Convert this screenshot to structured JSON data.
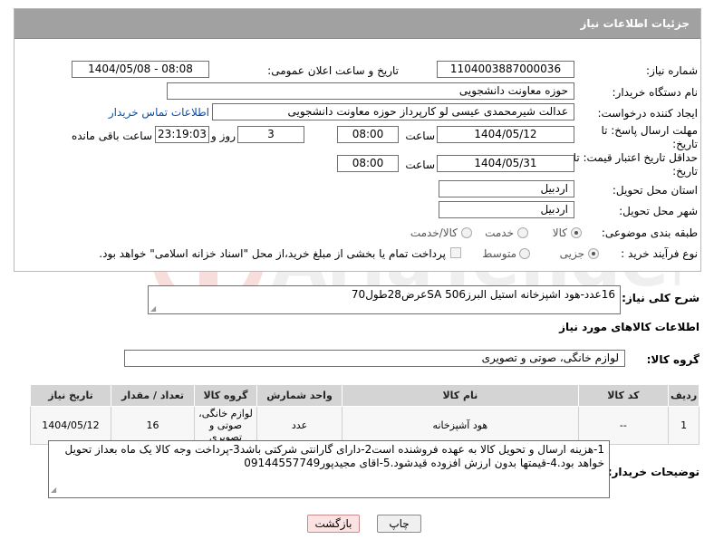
{
  "panel": {
    "title": "جزئیات اطلاعات نیاز"
  },
  "fields": {
    "need_number_label": "شماره نیاز:",
    "need_number": "1104003887000036",
    "announce_label": "تاریخ و ساعت اعلان عمومی:",
    "announce_value": "1404/05/08 - 08:08",
    "buyer_org_label": "نام دستگاه خریدار:",
    "buyer_org": "حوزه معاونت دانشجویی",
    "requester_label": "ایجاد کننده درخواست:",
    "requester": "عدالت شیرمحمدی عیسی لو کارپرداز حوزه معاونت دانشجویی",
    "contact_link": "اطلاعات تماس خریدار",
    "reply_deadline_label": "مهلت ارسال پاسخ: تا تاریخ:",
    "reply_date": "1404/05/12",
    "time_label": "ساعت",
    "reply_time": "08:00",
    "days": "3",
    "days_label": "روز و",
    "remaining_time": "23:19:03",
    "remaining_label": "ساعت باقی مانده",
    "validity_label": "حداقل تاریخ اعتبار قیمت: تا تاریخ:",
    "validity_date": "1404/05/31",
    "validity_time": "08:00",
    "province_label": "استان محل تحویل:",
    "province": "اردبیل",
    "city_label": "شهر محل تحویل:",
    "city": "اردبیل",
    "category_label": "طبقه بندی موضوعی:",
    "category_options": [
      "کالا",
      "خدمت",
      "کالا/خدمت"
    ],
    "process_label": "نوع فرآیند خرید :",
    "process_options": [
      "جزیی",
      "متوسط"
    ],
    "payment_note": "پرداخت تمام یا بخشی از مبلغ خرید،از محل \"اسناد خزانه اسلامی\" خواهد بود."
  },
  "description": {
    "label": "شرح کلی نیاز:",
    "text": "16عدد-هود اشپزخانه استیل البرز506 SAعرض28طول70"
  },
  "goods": {
    "section_title": "اطلاعات کالاهای مورد نیاز",
    "group_label": "گروه کالا:",
    "group_value": "لوازم خانگی، صوتی و تصویری",
    "columns": [
      "ردیف",
      "کد کالا",
      "نام کالا",
      "واحد شمارش",
      "گروه کالا",
      "تعداد / مقدار",
      "تاریخ نیاز"
    ],
    "rows": [
      [
        "1",
        "--",
        "هود آشپزخانه",
        "عدد",
        "لوازم خانگی، صوتی و تصویری",
        "16",
        "1404/05/12"
      ]
    ]
  },
  "buyer_notes": {
    "label": "توضیحات خریدار:",
    "text": "1-هزینه ارسال و تحویل کالا به عهده فروشنده است2-دارای گارانتی شرکتی باشد3-پرداخت وجه کالا یک ماه بعداز تحویل خواهد بود.4-قیمتها بدون ارزش افزوده قیدشود.5-اقای مجیدپور09144557749"
  },
  "buttons": {
    "print": "چاپ",
    "back": "بازگشت"
  },
  "colors": {
    "header": "#a1a1a1",
    "link": "#0f4fa8",
    "back_button": "#fbe3e3"
  }
}
